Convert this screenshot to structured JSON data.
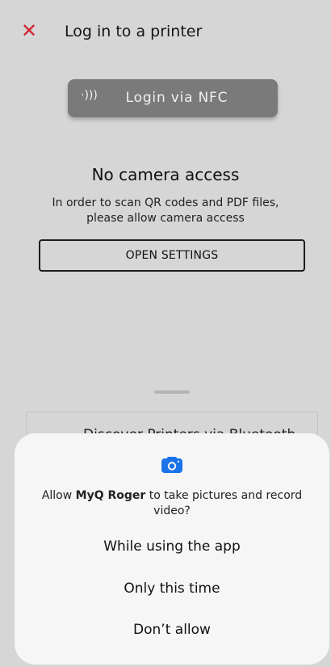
{
  "header": {
    "close_icon": "close-icon",
    "title": "Log in to a printer",
    "accent": "#d1212f"
  },
  "nfc": {
    "icon": "nfc-icon",
    "icon_glyph": "·)))",
    "label": "Login via NFC"
  },
  "camera": {
    "title": "No camera access",
    "description": "In order to scan QR codes and PDF files, please allow camera access",
    "button": "OPEN SETTINGS"
  },
  "discover": {
    "label": "Discover Printers via Bluetooth"
  },
  "dialog": {
    "icon": "camera-icon",
    "icon_color": "#1a73e8",
    "message_pre": "Allow ",
    "app_name": "MyQ Roger",
    "message_post": " to take pictures and record video?",
    "options": [
      "While using the app",
      "Only this time",
      "Don’t allow"
    ]
  }
}
